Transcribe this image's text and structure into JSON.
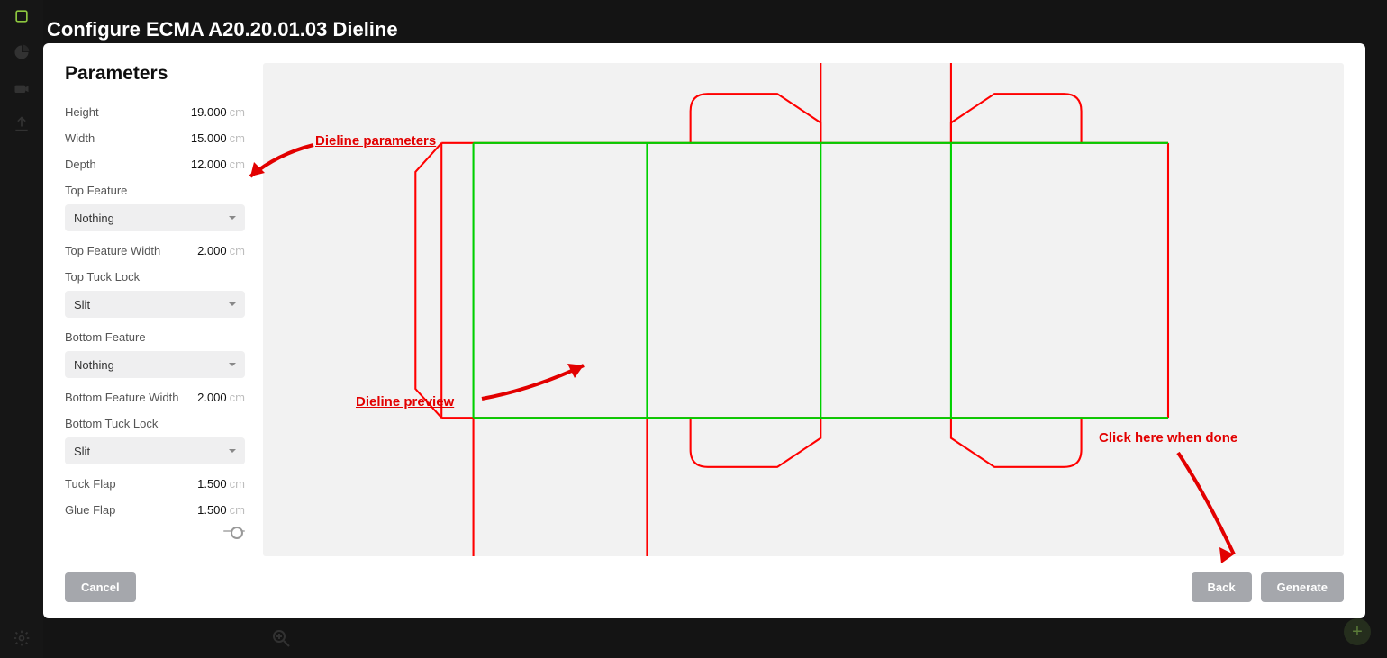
{
  "header": {
    "title": "Configure ECMA A20.20.01.03 Dieline"
  },
  "params": {
    "heading": "Parameters",
    "unit": "cm",
    "height": {
      "label": "Height",
      "value": "19.000"
    },
    "width": {
      "label": "Width",
      "value": "15.000"
    },
    "depth": {
      "label": "Depth",
      "value": "12.000"
    },
    "top_feature": {
      "label": "Top Feature",
      "value": "Nothing"
    },
    "top_feature_width": {
      "label": "Top Feature Width",
      "value": "2.000"
    },
    "top_tuck_lock": {
      "label": "Top Tuck Lock",
      "value": "Slit"
    },
    "bottom_feature": {
      "label": "Bottom Feature",
      "value": "Nothing"
    },
    "bottom_feature_width": {
      "label": "Bottom Feature Width",
      "value": "2.000"
    },
    "bottom_tuck_lock": {
      "label": "Bottom Tuck Lock",
      "value": "Slit"
    },
    "tuck_flap": {
      "label": "Tuck Flap",
      "value": "1.500"
    },
    "glue_flap": {
      "label": "Glue Flap",
      "value": "1.500"
    }
  },
  "buttons": {
    "cancel": "Cancel",
    "back": "Back",
    "generate": "Generate"
  },
  "annotations": {
    "params": "Dieline parameters",
    "preview": "Dieline preview",
    "done": "Click here when done"
  }
}
